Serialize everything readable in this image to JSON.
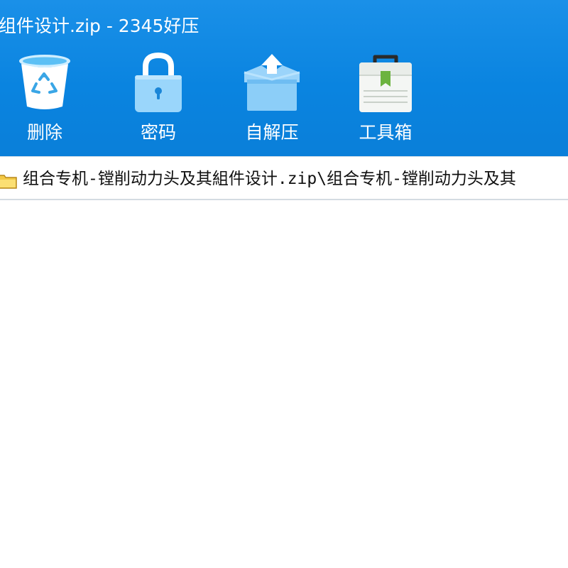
{
  "window": {
    "title": "组件设计.zip - 2345好压"
  },
  "toolbar": {
    "items": [
      {
        "label": "删除",
        "icon": "recycle-bin-icon"
      },
      {
        "label": "密码",
        "icon": "padlock-icon"
      },
      {
        "label": "自解压",
        "icon": "open-box-icon"
      },
      {
        "label": "工具箱",
        "icon": "toolbox-icon"
      }
    ]
  },
  "address_bar": {
    "icon": "folder-icon",
    "path": "组合专机-镗削动力头及其組件设计.zip\\组合专机-镗削动力头及其"
  },
  "colors": {
    "toolbar_bg": "#0a84e0",
    "icon_light_blue": "#8fd2fb",
    "icon_white": "#ffffff",
    "toolbox_green": "#6cb33f"
  }
}
